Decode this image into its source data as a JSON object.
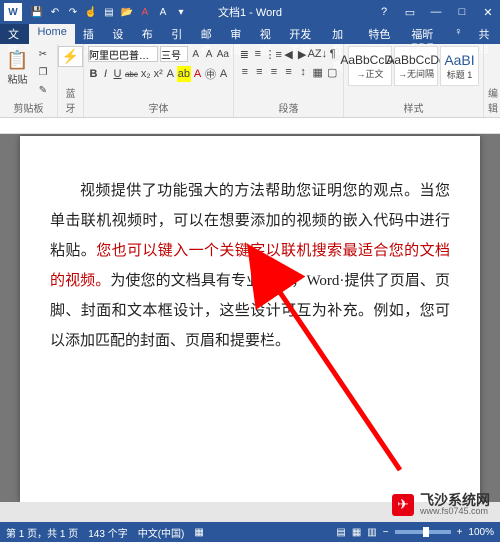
{
  "window": {
    "app_letter": "W",
    "title": "文档1 - Word",
    "controls": {
      "help": "?",
      "ribbon_toggle": "▭",
      "min": "—",
      "max": "□",
      "close": "✕"
    }
  },
  "qat": {
    "save": "💾",
    "undo": "↶",
    "redo": "↷",
    "touch": "☝",
    "new": "▤",
    "open": "📂",
    "a_red": "A",
    "cap_a": "A",
    "more": "▾"
  },
  "tabs": {
    "file": "文件",
    "items": [
      "Home",
      "插入",
      "设计",
      "布局",
      "引用",
      "邮件",
      "审阅",
      "视图",
      "开发工具",
      "加载项",
      "特色功能",
      "福昕PDF"
    ],
    "tell_me": "♀",
    "share": "共享",
    "active_index": 0
  },
  "ribbon": {
    "clipboard": {
      "paste_label": "粘贴",
      "cut": "✂",
      "copy": "❐",
      "painter": "✎",
      "group_label": "剪贴板",
      "bt_icon": "⚡"
    },
    "font": {
      "name": "阿里巴巴普…",
      "size": "三号",
      "grow": "A",
      "shrink": "A",
      "clear": "Aa",
      "phonetic": "㊥",
      "border": "A",
      "bold": "B",
      "italic": "I",
      "underline": "U",
      "strike": "abc",
      "sub": "x₂",
      "sup": "x²",
      "effects": "A",
      "highlight": "ab",
      "color": "A",
      "group_label": "字体"
    },
    "paragraph": {
      "bullets": "≣",
      "numbering": "≡",
      "multilevel": "⋮≡",
      "dec_indent": "◀",
      "inc_indent": "▶",
      "sort": "AZ↓",
      "marks": "¶",
      "align_l": "≡",
      "align_c": "≡",
      "align_r": "≡",
      "justify": "≡",
      "spacing": "↕",
      "shading": "▦",
      "borders": "▢",
      "group_label": "段落"
    },
    "styles": {
      "items": [
        {
          "preview": "AaBbCcDd",
          "label": "→正文"
        },
        {
          "preview": "AaBbCcDd",
          "label": "→无间隔"
        },
        {
          "preview": "AaBI",
          "label": "标题 1"
        }
      ],
      "group_label": "样式"
    },
    "editing": {
      "label": "编辑"
    }
  },
  "document": {
    "p1_before_red": "视频提供了功能强大的方法帮助您证明您的观点。当您单击联机视频时，可以在想要添加的视频的嵌入代码中进行粘贴。",
    "p1_red": "您也可以键入一个关键字以联机搜索最适合您的文档的视频。",
    "p1_after_red": "为使您的文档具有专业外观，Word·提供了页眉、页脚、封面和文本框设计，这些设计可互为补充。例如，您可以添加匹配的封面、页眉和提要栏。"
  },
  "statusbar": {
    "page": "第 1 页，共 1 页",
    "words": "143 个字",
    "lang": "中文(中国)",
    "insert": "▦",
    "views": {
      "read": "▤",
      "print": "▦",
      "web": "▥"
    },
    "zoom_minus": "−",
    "zoom_plus": "+",
    "zoom": "100%"
  },
  "watermark": {
    "brand": "飞沙系统网",
    "url": "www.fs0745.com",
    "logo_glyph": "✈"
  }
}
